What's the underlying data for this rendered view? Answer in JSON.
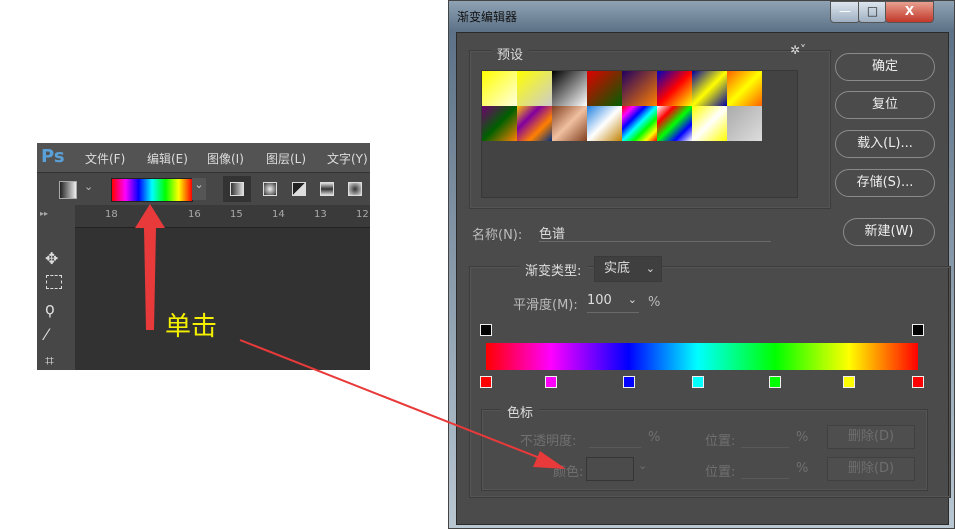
{
  "ps": {
    "logo": "Ps",
    "menu": [
      "文件(F)",
      "编辑(E)",
      "图像(I)",
      "图层(L)",
      "文字(Y)"
    ],
    "ruler_ticks": [
      "18",
      "16",
      "15",
      "14",
      "13",
      "12"
    ],
    "gradient_colors": [
      "#ff0000",
      "#ff00ff",
      "#0000ff",
      "#00ffff",
      "#00ff00",
      "#ffff00",
      "#ff0000"
    ]
  },
  "annotation": {
    "label": "单击",
    "color": "#f5f000",
    "arrow_color": "#e83a3a"
  },
  "dialog": {
    "title": "渐变编辑器",
    "window_buttons": {
      "minimize": "—",
      "maximize": "□",
      "close": "X"
    },
    "presets_label": "预设",
    "presets": [
      [
        "#ffff00",
        "#ffffe0"
      ],
      [
        "#ffff00",
        "#cccccc"
      ],
      [
        "#000000",
        "#ffffff"
      ],
      [
        "#e00000",
        "#006000"
      ],
      [
        "#200060",
        "#ff8000"
      ],
      [
        "#0000c0",
        "#ff0000",
        "#ffff00"
      ],
      [
        "#0000a0",
        "#ffff00",
        "#0000a0"
      ],
      [
        "#ff6000",
        "#ffff00",
        "#ff6000"
      ],
      [
        "#700070",
        "#006000",
        "#ff8000"
      ],
      [
        "#ffc000",
        "#8000a0",
        "#ff8000",
        "#003080"
      ],
      [
        "#804020",
        "#f0c0a0",
        "#804020"
      ],
      [
        "#2080e0",
        "#ffffff",
        "#c08000"
      ],
      [
        "#ff0000",
        "#ff00ff",
        "#0000ff",
        "#00ffff",
        "#00ff00",
        "#ffff00",
        "#ff0000"
      ],
      [
        "#ffffff",
        "#ff0000",
        "#00ff00",
        "#0000ff",
        "#ffffff"
      ],
      [
        "#ffff00",
        "#ffffff",
        "#ffff00"
      ],
      [
        "#aaaaaa",
        "#dddddd"
      ]
    ],
    "buttons": {
      "ok": "确定",
      "reset": "复位",
      "load": "载入(L)...",
      "save": "存储(S)...",
      "new": "新建(W)"
    },
    "name_label": "名称(N):",
    "name_value": "色谱",
    "type_label": "渐变类型:",
    "type_value": "实底",
    "smooth_label": "平滑度(M):",
    "smooth_value": "100",
    "percent": "%",
    "opacity_stops": [
      0,
      100
    ],
    "color_stops": [
      {
        "pos": 0,
        "color": "#ff0000"
      },
      {
        "pos": 15,
        "color": "#ff00ff"
      },
      {
        "pos": 33,
        "color": "#0000ff"
      },
      {
        "pos": 49,
        "color": "#00ffff"
      },
      {
        "pos": 67,
        "color": "#00ff00"
      },
      {
        "pos": 84,
        "color": "#ffff00"
      },
      {
        "pos": 100,
        "color": "#ff0000"
      }
    ],
    "stops_group": {
      "label": "色标",
      "opacity_label": "不透明度:",
      "color_label": "颜色:",
      "location_label": "位置:",
      "delete_label": "删除(D)"
    }
  }
}
